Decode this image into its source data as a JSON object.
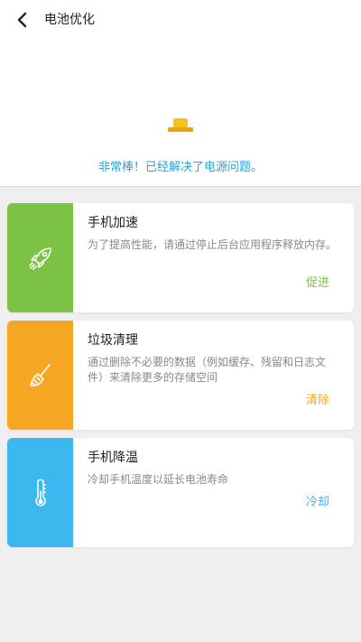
{
  "header": {
    "title": "电池优化",
    "back_icon": "chevron-left-icon"
  },
  "status": {
    "icon": "battery-icon",
    "message": "非常棒！已经解决了电源问题。",
    "color": "#2aa3d6"
  },
  "cards": [
    {
      "title": "手机加速",
      "description": "为了提高性能，请通过停止后台应用程序释放内存。",
      "action": "促进",
      "icon": "rocket-icon",
      "color": "#7cc245"
    },
    {
      "title": "垃圾清理",
      "description": "通过删除不必要的数据（例如缓存、残留和日志文件）来清除更多的存储空间",
      "action": "清除",
      "icon": "broom-icon",
      "color": "#f5a623"
    },
    {
      "title": "手机降温",
      "description": "冷却手机温度以延长电池寿命",
      "action": "冷却",
      "icon": "thermometer-icon",
      "color": "#3db8ee"
    }
  ]
}
